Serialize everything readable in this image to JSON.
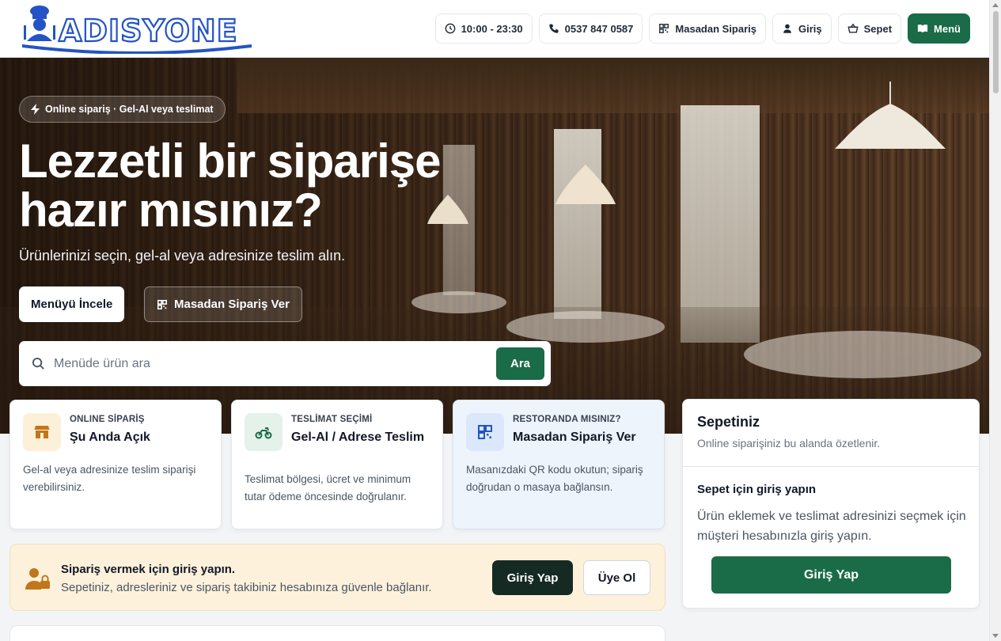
{
  "header": {
    "logo_text": "ADISYONE",
    "hours": "10:00 - 23:30",
    "phone": "0537 847 0587",
    "table_order": "Masadan Sipariş",
    "login": "Giriş",
    "cart": "Sepet",
    "menu": "Menü"
  },
  "hero": {
    "badge": "Online sipariş · Gel-Al veya teslimat",
    "title_line1": "Lezzetli bir siparişe",
    "title_line2": "hazır mısınız?",
    "subtitle": "Ürünlerinizi seçin, gel-al veya adresinize teslim alın.",
    "menu_button": "Menüyü İncele",
    "table_button": "Masadan Sipariş Ver",
    "search_placeholder": "Menüde ürün ara",
    "search_button": "Ara"
  },
  "cards": [
    {
      "icon": "store-icon",
      "kicker": "ONLINE SİPARİŞ",
      "title": "Şu Anda Açık",
      "desc": "Gel-al veya adresinize teslim siparişi verebilirsiniz."
    },
    {
      "icon": "motorcycle-icon",
      "kicker": "TESLİMAT SEÇİMİ",
      "title": "Gel-Al / Adrese Teslim",
      "desc": "Teslimat bölgesi, ücret ve minimum tutar ödeme öncesinde doğrulanır."
    },
    {
      "icon": "qr-code-icon",
      "kicker": "RESTORANDA MISINIZ?",
      "title": "Masadan Sipariş Ver",
      "desc": "Masanızdaki QR kodu okutun; sipariş doğrudan o masaya bağlansın."
    }
  ],
  "login_banner": {
    "title": "Sipariş vermek için giriş yapın.",
    "subtitle": "Sepetiniz, adresleriniz ve sipariş takibiniz hesabınıza güvenle bağlanır.",
    "login_button": "Giriş Yap",
    "register_button": "Üye Ol"
  },
  "cart_panel": {
    "title": "Sepetiniz",
    "subtitle": "Online siparişiniz bu alanda özetlenir.",
    "login_title": "Sepet için giriş yapın",
    "login_desc": "Ürün eklemek ve teslimat adresinizi seçmek için müşteri hesabınızla giriş yapın.",
    "login_button": "Giriş Yap"
  },
  "colors": {
    "brand_green": "#1a6b47",
    "logo_blue": "#2353c6",
    "banner_bg": "#fdf1dc",
    "dark_button": "#152a22"
  }
}
